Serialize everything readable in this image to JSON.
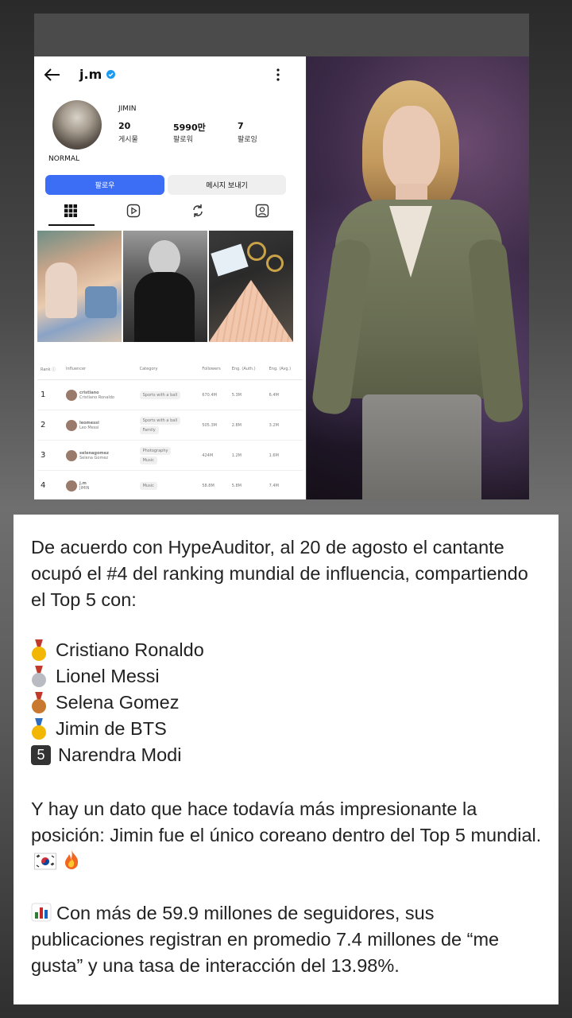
{
  "profile": {
    "username": "j.m",
    "display_name": "JIMIN",
    "badge": "NORMAL",
    "stats": [
      {
        "value": "20",
        "label": "게시물"
      },
      {
        "value": "5990만",
        "label": "팔로워"
      },
      {
        "value": "7",
        "label": "팔로잉"
      }
    ],
    "follow_label": "팔로우",
    "message_label": "메시지 보내기"
  },
  "ranking": {
    "headers": [
      "Rank ⓘ",
      "Influencer",
      "Category",
      "Followers",
      "Eng. (Auth.)",
      "Eng. (Avg.)"
    ],
    "rows": [
      {
        "rank": "1",
        "handle": "cristiano",
        "name": "Cristiano Ronaldo",
        "categories": [
          "Sports with a ball"
        ],
        "followers": "670.4M",
        "eng_auth": "5.3M",
        "eng_avg": "6.4M"
      },
      {
        "rank": "2",
        "handle": "leomessi",
        "name": "Leo Messi",
        "categories": [
          "Sports with a ball",
          "Family"
        ],
        "followers": "505.3M",
        "eng_auth": "2.8M",
        "eng_avg": "3.2M"
      },
      {
        "rank": "3",
        "handle": "selenagomez",
        "name": "Selena Gomez",
        "categories": [
          "Photography",
          "Music"
        ],
        "followers": "424M",
        "eng_auth": "1.2M",
        "eng_avg": "1.6M"
      },
      {
        "rank": "4",
        "handle": "j.m",
        "name": "JIMIN",
        "categories": [
          "Music"
        ],
        "followers": "58.8M",
        "eng_auth": "5.8M",
        "eng_avg": "7.4M"
      }
    ]
  },
  "caption": {
    "intro": "De acuerdo con HypeAuditor, al 20 de agosto el cantante ocupó el #4 del ranking mundial de influencia, compartiendo el Top 5 con:",
    "list": [
      {
        "icon": "gold-medal-icon",
        "color": "#f2b705",
        "text": "Cristiano Ronaldo"
      },
      {
        "icon": "silver-medal-icon",
        "color": "#b8bcc2",
        "text": "Lionel Messi"
      },
      {
        "icon": "bronze-medal-icon",
        "color": "#c8782f",
        "text": "Selena Gomez"
      },
      {
        "icon": "sports-medal-icon",
        "color": "#f2b705",
        "text": "Jimin de BTS"
      },
      {
        "icon": "keycap-5-icon",
        "glyph": "5",
        "text": "Narendra Modi"
      }
    ],
    "note": "Y hay un dato que hace todavía más impresionante la posición: Jimin fue el único coreano dentro del Top 5 mundial.",
    "stats_text": "Con más de 59.9 millones de seguidores, sus publicaciones registran en promedio 7.4 millones de “me gusta” y una tasa de interacción del 13.98%."
  }
}
